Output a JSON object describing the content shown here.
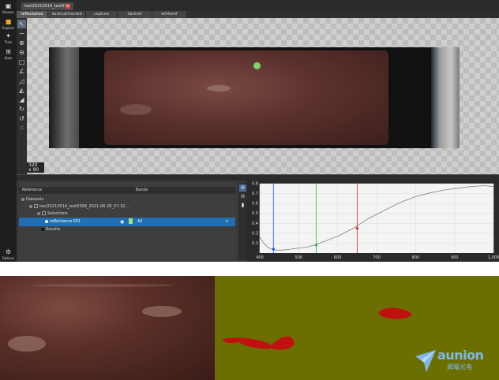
{
  "rail": {
    "items": [
      {
        "label": "Browse",
        "icon": "folder-icon"
      },
      {
        "label": "Explore",
        "icon": "explore-icon"
      },
      {
        "label": "Train",
        "icon": "train-icon"
      },
      {
        "label": "Apps",
        "icon": "apps-icon"
      }
    ],
    "options_label": "Options"
  },
  "file_tab": {
    "label": "test20210514_test03..."
  },
  "tabs": [
    {
      "label": "reflectance"
    },
    {
      "label": "darkcubtracted"
    },
    {
      "label": "capture"
    },
    {
      "label": "darkref"
    },
    {
      "label": "whiteref"
    }
  ],
  "canvas": {
    "zoom_value": "320",
    "zoom_sub": "x 90"
  },
  "panel": {
    "col_reference": "Reference",
    "col_bands": "Bands",
    "rows": [
      {
        "label": "Datasets"
      },
      {
        "label": "test20210514_test0308_2021-06-28_07-32..."
      },
      {
        "label": "Selections"
      },
      {
        "label": "reflectance.001"
      },
      {
        "label": "Results"
      }
    ],
    "bands_value": "All"
  },
  "chart_data": {
    "type": "line",
    "title": "",
    "xlabel": "",
    "ylabel": "",
    "xlim": [
      400,
      1000
    ],
    "ylim": [
      0.1,
      0.8
    ],
    "x_ticks": [
      "400",
      "500",
      "600",
      "700",
      "800",
      "900",
      "1,000"
    ],
    "y_ticks": [
      "0.8",
      "0.7",
      "0.6",
      "0.5",
      "0.4",
      "0.3",
      "0.2"
    ],
    "grid": true,
    "series": [
      {
        "x": [
          400,
          410,
          420,
          430,
          440,
          450,
          460,
          470,
          480,
          490,
          500,
          520,
          540,
          560,
          580,
          600,
          620,
          640,
          660,
          680,
          700,
          720,
          740,
          760,
          780,
          800,
          820,
          840,
          860,
          880,
          900,
          920,
          940,
          960,
          980,
          1000
        ],
        "values": [
          0.26,
          0.2,
          0.16,
          0.14,
          0.13,
          0.13,
          0.13,
          0.135,
          0.14,
          0.145,
          0.15,
          0.16,
          0.18,
          0.21,
          0.24,
          0.27,
          0.31,
          0.35,
          0.4,
          0.45,
          0.49,
          0.53,
          0.57,
          0.61,
          0.64,
          0.67,
          0.69,
          0.71,
          0.725,
          0.74,
          0.75,
          0.76,
          0.77,
          0.775,
          0.78,
          0.77
        ]
      }
    ],
    "markers": [
      {
        "x": 435,
        "color": "#2050e0"
      },
      {
        "x": 545,
        "color": "#30b040"
      },
      {
        "x": 650,
        "color": "#d02020"
      }
    ]
  },
  "brand": {
    "name": "aunion",
    "sub": "翼耀光电"
  },
  "colors": {
    "accent": "#1f6fb2",
    "mask_red": "#c01010",
    "mask_bg": "#6b6e00"
  }
}
